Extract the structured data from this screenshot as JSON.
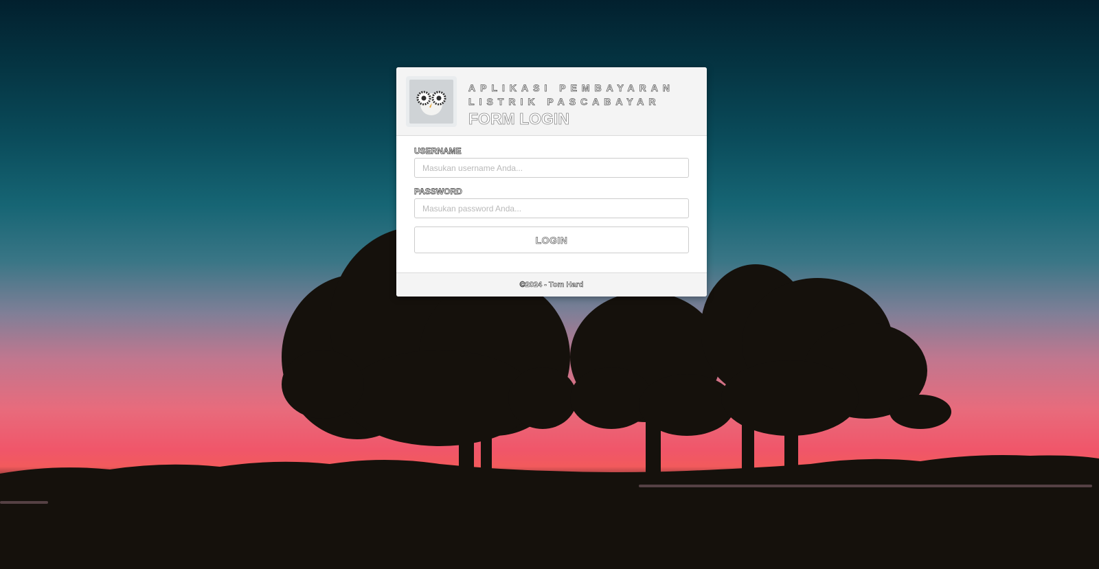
{
  "background": {
    "icon": "sunset-trees-landscape"
  },
  "login_card": {
    "logo_icon": "owl-logo-icon",
    "app_title": "APLIKASI PEMBAYARAN LISTRIK PASCABAYAR",
    "form_title": "FORM LOGIN",
    "username_label": "USERNAME",
    "username_placeholder": "Masukan username Anda...",
    "username_value": "",
    "password_label": "PASSWORD",
    "password_placeholder": "Masukan password Anda...",
    "password_value": "",
    "login_button": "LOGIN",
    "footer": "©2024 - Tom Hard"
  }
}
